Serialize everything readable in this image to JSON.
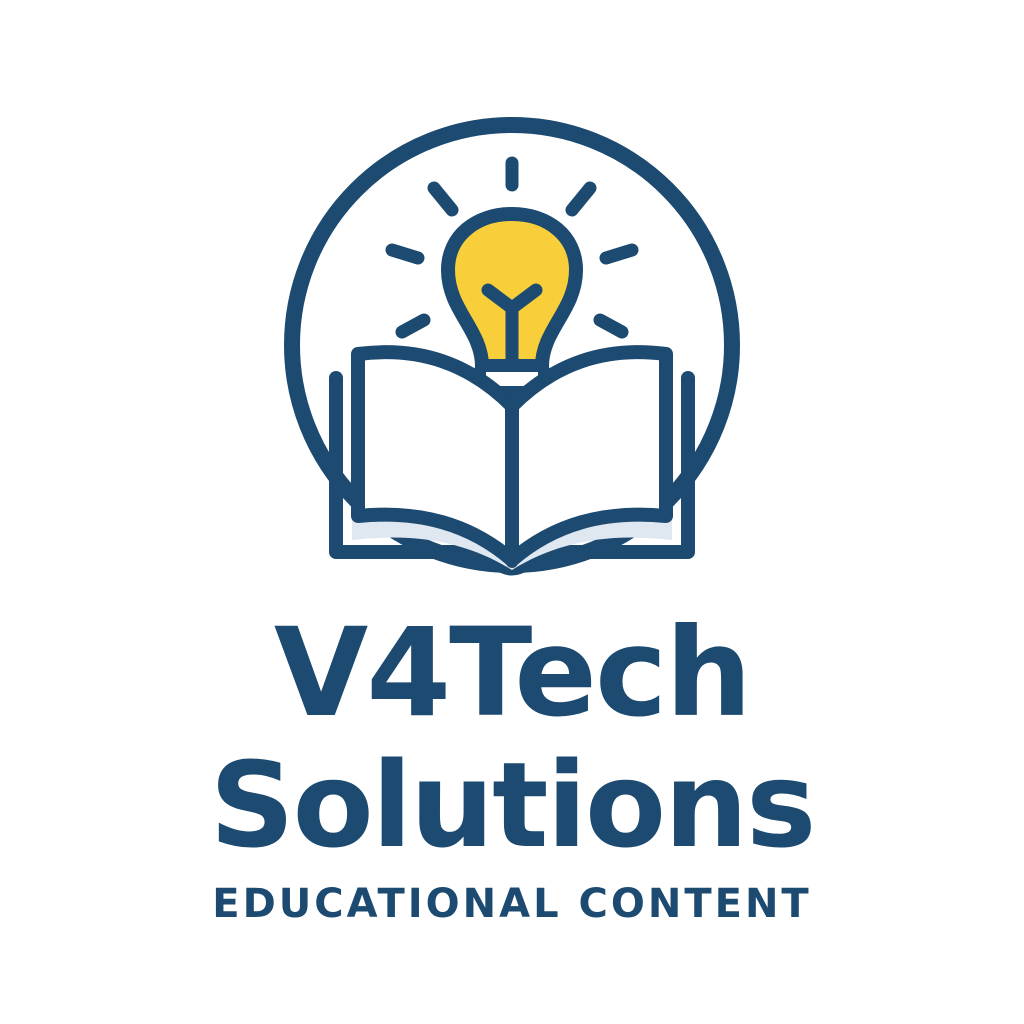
{
  "logo": {
    "name_line_1": "V4Tech",
    "name_line_2": "Solutions",
    "tagline": "EDUCATIONAL CONTENT",
    "icons": [
      "circle-frame-icon",
      "lightbulb-icon",
      "light-rays-icon",
      "open-book-icon"
    ]
  },
  "colors": {
    "primary": "#1c4a70",
    "accent": "#f8ce3a",
    "background": "#ffffff",
    "page_shadow": "#dfe7f0"
  }
}
